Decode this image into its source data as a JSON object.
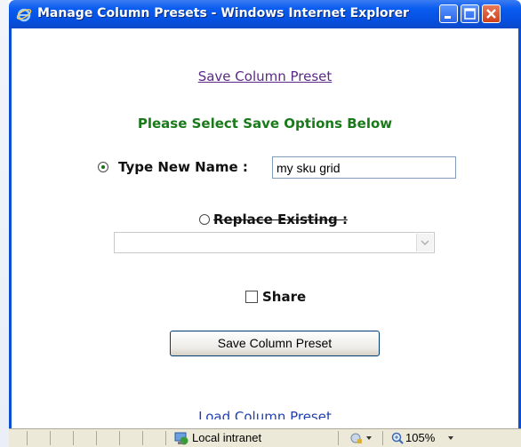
{
  "window": {
    "title": "Manage Column Presets - Windows Internet Explorer"
  },
  "page": {
    "save_link": "Save Column Preset",
    "heading": "Please Select Save Options Below",
    "type_new_label": "Type New Name :",
    "type_new_value": "my sku grid",
    "replace_label": "Replace Existing :",
    "share_label": "Share",
    "save_button": "Save Column Preset",
    "load_link": "Load Column Preset"
  },
  "status": {
    "zone": "Local intranet",
    "zoom": "105%"
  },
  "icons": {
    "ie": "ie-logo-icon",
    "minimize": "minimize-icon",
    "maximize": "maximize-icon",
    "close": "close-icon",
    "zone": "intranet-globe-icon",
    "security": "security-icon",
    "zoom": "zoom-magnifier-icon"
  },
  "colors": {
    "titlebar": "#0550e0",
    "heading": "#1a7a1a",
    "link_visited": "#5b2a86",
    "link": "#1f3fb3"
  }
}
